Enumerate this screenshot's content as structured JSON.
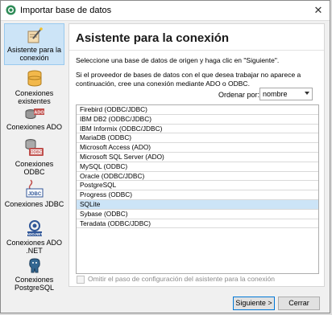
{
  "window": {
    "title": "Importar base de datos",
    "close_glyph": "✕"
  },
  "sidebar": {
    "items": [
      {
        "label": "Asistente para la conexión",
        "icon": "wizard-icon",
        "active": true
      },
      {
        "label": "Conexiones existentes",
        "icon": "database-icon"
      },
      {
        "label": "Conexiones ADO",
        "icon": "ado-icon"
      },
      {
        "label": "Conexiones ODBC",
        "icon": "odbc-icon"
      },
      {
        "label": "Conexiones JDBC",
        "icon": "jdbc-icon"
      },
      {
        "label": "Conexiones ADO .NET",
        "icon": "ado-net-icon"
      },
      {
        "label": "Conexiones PostgreSQL",
        "icon": "postgresql-icon"
      }
    ]
  },
  "main": {
    "heading": "Asistente para la conexión",
    "intro": "Seleccione una base de datos de origen y haga clic en \"Siguiente\".",
    "hint": "Si el proveedor de bases de datos con el que desea trabajar no aparece a continuación, cree una conexión mediante ADO o ODBC.",
    "sort_label": "Ordenar por:",
    "sort_value": "nombre",
    "databases": [
      "Firebird (ODBC/JDBC)",
      "IBM DB2 (ODBC/JDBC)",
      "IBM Informix (ODBC/JDBC)",
      "MariaDB (ODBC)",
      "Microsoft Access (ADO)",
      "Microsoft SQL Server (ADO)",
      "MySQL (ODBC)",
      "Oracle (ODBC/JDBC)",
      "PostgreSQL",
      "Progress (ODBC)",
      "SQLite",
      "Sybase (ODBC)",
      "Teradata (ODBC/JDBC)"
    ],
    "selected_database": "SQLite",
    "skip_label": "Omitir el paso de configuración del asistente para la conexión"
  },
  "buttons": {
    "next": "Siguiente >",
    "cancel": "Cerrar"
  },
  "colors": {
    "accent": "#0078d7",
    "selection": "#cce4f7"
  }
}
